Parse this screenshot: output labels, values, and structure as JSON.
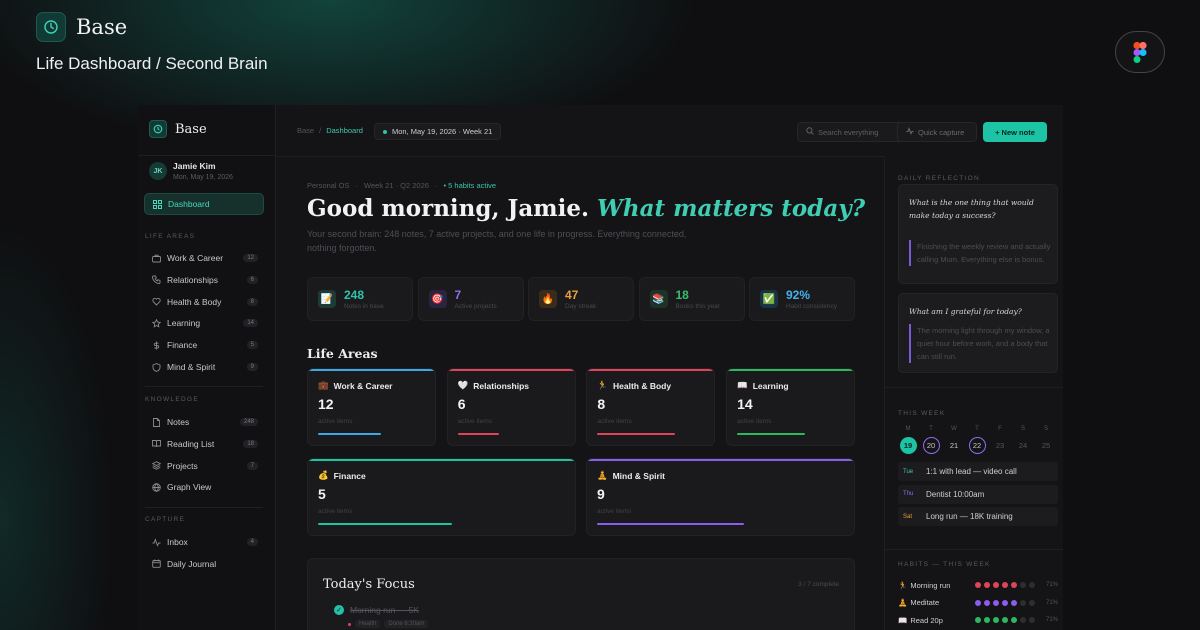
{
  "banner": {
    "brand": "Base",
    "subtitle": "Life Dashboard / Second Brain"
  },
  "colors": {
    "accent": "#1cc3a4",
    "purple": "#7a5bd6",
    "red": "#e0445a",
    "green": "#2bb85e",
    "blue": "#3da8e6",
    "gold": "#d9a43a"
  },
  "sidebar": {
    "brand": "Base",
    "user": {
      "initials": "JK",
      "name": "Jamie Kim",
      "date": "Mon, May 19, 2026"
    },
    "active_item": "Dashboard",
    "life_areas_label": "LIFE AREAS",
    "life_areas": [
      {
        "label": "Work & Career",
        "count": "12",
        "icon": "briefcase-icon"
      },
      {
        "label": "Relationships",
        "count": "6",
        "icon": "phone-icon"
      },
      {
        "label": "Health & Body",
        "count": "8",
        "icon": "heart-icon"
      },
      {
        "label": "Learning",
        "count": "14",
        "icon": "star-icon"
      },
      {
        "label": "Finance",
        "count": "5",
        "icon": "dollar-icon"
      },
      {
        "label": "Mind & Spirit",
        "count": "9",
        "icon": "shield-icon"
      }
    ],
    "knowledge_label": "KNOWLEDGE",
    "knowledge": [
      {
        "label": "Notes",
        "count": "248",
        "icon": "document-icon"
      },
      {
        "label": "Reading List",
        "count": "18",
        "icon": "book-icon"
      },
      {
        "label": "Projects",
        "count": "7",
        "icon": "layers-icon"
      },
      {
        "label": "Graph View",
        "count": "",
        "icon": "globe-icon"
      }
    ],
    "capture_label": "CAPTURE",
    "capture": [
      {
        "label": "Inbox",
        "count": "4",
        "icon": "activity-icon"
      },
      {
        "label": "Daily Journal",
        "count": "",
        "icon": "calendar-icon"
      }
    ]
  },
  "topbar": {
    "crumb_root": "Base",
    "crumb_current": "Dashboard",
    "date_chip": "Mon, May 19, 2026 · Week 21",
    "search_placeholder": "Search everything",
    "quick_capture": "Quick capture",
    "new_note": "+ New note"
  },
  "hero": {
    "eyebrow": [
      "Personal OS",
      "Week 21 · Q2 2026"
    ],
    "habits_active": "5 habits active",
    "greeting": "Good morning, Jamie.",
    "question": "What matters today?",
    "intro": "Your second brain: 248 notes, 7 active projects, and one life in progress. Everything connected, nothing forgotten."
  },
  "stats": [
    {
      "value": "248",
      "label": "Notes in base",
      "emoji": "📝",
      "color": "#2ec4a8",
      "bg": "#1d3a33"
    },
    {
      "value": "7",
      "label": "Active projects",
      "emoji": "🎯",
      "color": "#8f6cf0",
      "bg": "#2a2440"
    },
    {
      "value": "47",
      "label": "Day streak",
      "emoji": "🔥",
      "color": "#e6a23c",
      "bg": "#3a2c1a"
    },
    {
      "value": "18",
      "label": "Books this year",
      "emoji": "📚",
      "color": "#36c06b",
      "bg": "#1c3325"
    },
    {
      "value": "92%",
      "label": "Habit consistency",
      "emoji": "✅",
      "color": "#44b3ea",
      "bg": "#193246"
    }
  ],
  "life_areas": {
    "heading": "Life Areas",
    "items": [
      {
        "title": "Work & Career",
        "emoji": "💼",
        "value": "12",
        "sub": "active items",
        "color": "#3da8e6",
        "progress": 0.58
      },
      {
        "title": "Relationships",
        "emoji": "🤍",
        "value": "6",
        "sub": "active items",
        "color": "#e0445a",
        "progress": 0.38
      },
      {
        "title": "Health & Body",
        "emoji": "🏃",
        "value": "8",
        "sub": "active items",
        "color": "#e0445a",
        "progress": 0.72
      },
      {
        "title": "Learning",
        "emoji": "📖",
        "value": "14",
        "sub": "active items",
        "color": "#2bb85e",
        "progress": 0.62
      },
      {
        "title": "Finance",
        "emoji": "💰",
        "value": "5",
        "sub": "active items",
        "color": "#1cc3a4",
        "progress": 0.54
      },
      {
        "title": "Mind & Spirit",
        "emoji": "🧘",
        "value": "9",
        "sub": "active items",
        "color": "#8a5cf0",
        "progress": 0.59
      }
    ]
  },
  "focus": {
    "title": "Today's Focus",
    "count": "3 / 7 complete",
    "task": "Morning run — 5K",
    "tags": [
      "Health",
      "Done 6:30am"
    ]
  },
  "right": {
    "reflection_label": "DAILY REFLECTION",
    "q1": "What is the one thing that would make today a success?",
    "a1": "Finishing the weekly review and actually calling Mum. Everything else is bonus.",
    "q2": "What am I grateful for today?",
    "a2": "The morning light through my window, a quiet hour before work, and a body that can still run.",
    "week_label": "THIS WEEK",
    "weekdays": [
      "M",
      "T",
      "W",
      "T",
      "F",
      "S",
      "S"
    ],
    "days": [
      "19",
      "20",
      "21",
      "22",
      "23",
      "24",
      "25"
    ],
    "events": [
      {
        "day": "Tue",
        "text": "1:1 with lead — video call",
        "color": "#3fc7b0"
      },
      {
        "day": "Thu",
        "text": "Dentist 10:00am",
        "color": "#8f6cf0"
      },
      {
        "day": "Sat",
        "text": "Long run — 18K training",
        "color": "#e6a23c"
      }
    ],
    "habits_label": "HABITS — THIS WEEK",
    "habits": [
      {
        "label": "Morning run",
        "emoji": "🏃",
        "pct": "71%",
        "color": "#e0445a",
        "done": 5
      },
      {
        "label": "Meditate",
        "emoji": "🧘",
        "pct": "71%",
        "color": "#8a5cf0",
        "done": 5
      },
      {
        "label": "Read 20p",
        "emoji": "📖",
        "pct": "71%",
        "color": "#2bb85e",
        "done": 5
      }
    ]
  }
}
